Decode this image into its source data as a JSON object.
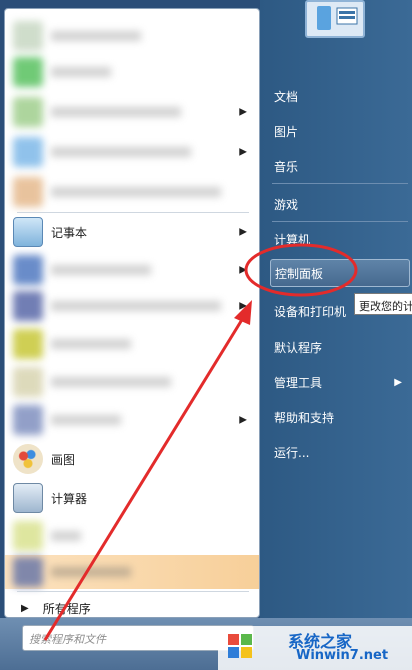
{
  "left_pane": {
    "pinned": [
      {
        "label": "记事本",
        "icon": "notepad-icon",
        "has_arrow": true
      },
      {
        "label": "画图",
        "icon": "paint-icon",
        "has_arrow": false
      },
      {
        "label": "计算器",
        "icon": "calculator-icon",
        "has_arrow": false
      }
    ],
    "all_programs": "所有程序",
    "search_placeholder": "搜索程序和文件"
  },
  "right_pane": {
    "items": [
      {
        "label": "文档"
      },
      {
        "label": "图片"
      },
      {
        "label": "音乐"
      },
      {
        "label": "游戏"
      },
      {
        "label": "计算机"
      },
      {
        "label": "控制面板",
        "highlighted": true
      },
      {
        "label": "设备和打印机"
      },
      {
        "label": "默认程序"
      },
      {
        "label": "管理工具",
        "has_arrow": true
      },
      {
        "label": "帮助和支持"
      },
      {
        "label": "运行..."
      }
    ],
    "tooltip": "更改您的计"
  },
  "colors": {
    "annotation_red": "#e32b2b",
    "watermark_blue": "#1766c6"
  },
  "watermark": {
    "text": "系统之家",
    "url": "Winwin7.net"
  }
}
